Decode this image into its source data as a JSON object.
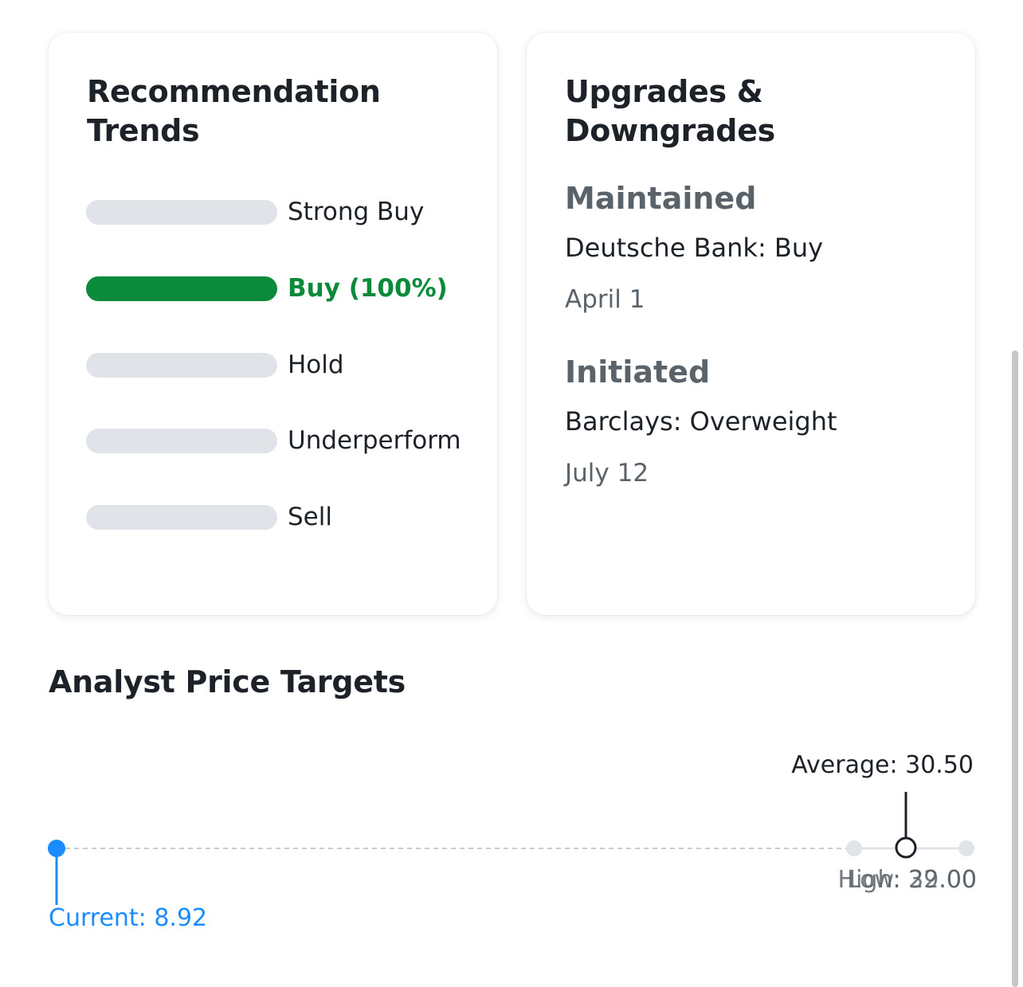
{
  "recommendation_trends": {
    "title": "Recommendation Trends",
    "rows": [
      {
        "label": "Strong Buy",
        "fraction": 0
      },
      {
        "label": "Buy (100%)",
        "fraction": 1
      },
      {
        "label": "Hold",
        "fraction": 0
      },
      {
        "label": "Underperform",
        "fraction": 0
      },
      {
        "label": "Sell",
        "fraction": 0
      }
    ],
    "active_color": "#0a8a3a",
    "inactive_color": "#e0e4e9"
  },
  "upgrades_downgrades": {
    "title": "Upgrades & Downgrades",
    "items": [
      {
        "action": "Maintained",
        "firm": "Deutsche Bank: Buy",
        "date": "April 1"
      },
      {
        "action": "Initiated",
        "firm": "Barclays: Overweight",
        "date": "July 12"
      }
    ]
  },
  "price_targets": {
    "title": "Analyst Price Targets",
    "average_label": "Average: 30.50",
    "current_label": "Current: 8.92",
    "low_label": "Low: 29.00",
    "high_label": "High: 32.00",
    "current": 8.92,
    "average": 30.5,
    "low": 29.0,
    "high": 32.0,
    "current_color": "#1a8cff"
  }
}
